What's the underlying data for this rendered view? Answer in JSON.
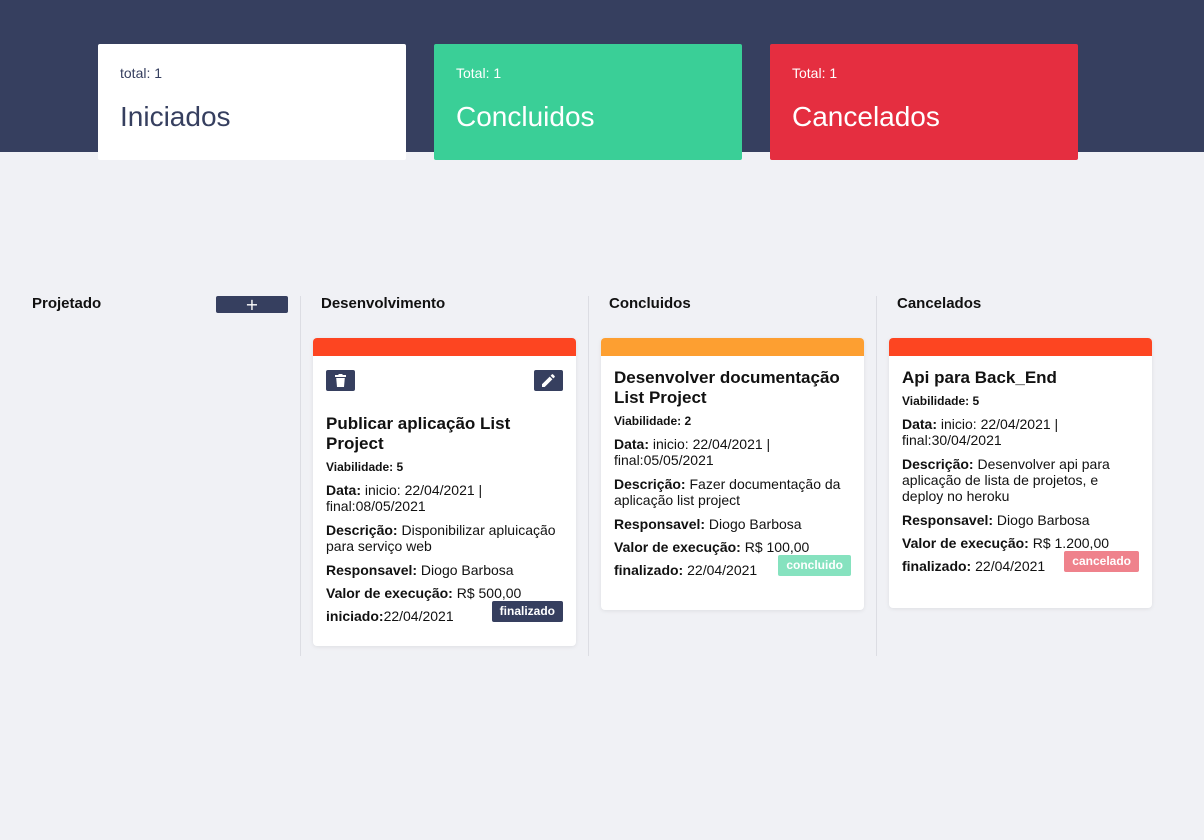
{
  "summary": {
    "started": {
      "total": "total: 1",
      "title": "Iniciados"
    },
    "done": {
      "total": "Total: 1",
      "title": "Concluidos"
    },
    "cancelled": {
      "total": "Total: 1",
      "title": "Cancelados"
    }
  },
  "columns": {
    "planned": {
      "title": "Projetado",
      "add_label": "+"
    },
    "development": {
      "title": "Desenvolvimento"
    },
    "done": {
      "title": "Concluidos"
    },
    "cancelled": {
      "title": "Cancelados"
    }
  },
  "cards": {
    "development": {
      "bar_color": "#fd4521",
      "title": "Publicar aplicação List Project",
      "viability": "Viabilidade: 5",
      "date_label": "Data:",
      "date_value": " inicio: 22/04/2021 | final:08/05/2021",
      "desc_label": "Descrição:",
      "desc_value": " Disponibilizar apluicação para serviço web",
      "resp_label": "Responsavel:",
      "resp_value": " Diogo Barbosa",
      "value_label": "Valor de execução:",
      "value_value": " R$ 500,00",
      "last_label": "iniciado:",
      "last_value": "22/04/2021",
      "badge": "finalizado",
      "badge_color": "#363f5f"
    },
    "done": {
      "bar_color": "#fd9f31",
      "title": "Desenvolver documentação List Project",
      "viability": "Viabilidade: 2",
      "date_label": "Data:",
      "date_value": " inicio: 22/04/2021 | final:05/05/2021",
      "desc_label": "Descrição:",
      "desc_value": " Fazer documentação da aplicação list project",
      "resp_label": "Responsavel:",
      "resp_value": " Diogo Barbosa",
      "value_label": "Valor de execução:",
      "value_value": " R$ 100,00",
      "last_label": "finalizado:",
      "last_value": " 22/04/2021",
      "badge": "concluido",
      "badge_color": "#86e2bf"
    },
    "cancelled": {
      "bar_color": "#fd4521",
      "title": "Api para Back_End",
      "viability": "Viabilidade: 5",
      "date_label": "Data:",
      "date_value": " inicio: 22/04/2021 | final:30/04/2021",
      "desc_label": "Descrição:",
      "desc_value": " Desenvolver api para aplicação de lista de projetos, e deploy no heroku",
      "resp_label": "Responsavel:",
      "resp_value": " Diogo Barbosa",
      "value_label": "Valor de execução:",
      "value_value": " R$ 1.200,00",
      "last_label": "finalizado:",
      "last_value": " 22/04/2021",
      "badge": "cancelado",
      "badge_color": "#ef828c"
    }
  },
  "icons": {
    "delete": "trash-icon",
    "edit": "pencil-icon"
  }
}
